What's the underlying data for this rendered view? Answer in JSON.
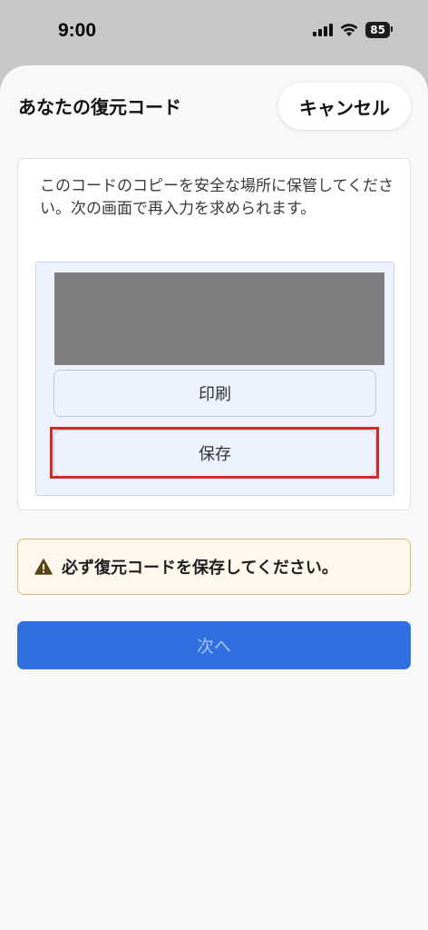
{
  "status_bar": {
    "time": "9:00",
    "battery": "85"
  },
  "sheet": {
    "title": "あなたの復元コード",
    "cancel_label": "キャンセル"
  },
  "card": {
    "description": "このコードのコピーを安全な場所に保管してください。次の画面で再入力を求められます。",
    "print_label": "印刷",
    "save_label": "保存"
  },
  "warning": {
    "text": "必ず復元コードを保存してください。",
    "icon": "warning-triangle-icon"
  },
  "footer": {
    "next_label": "次へ"
  },
  "colors": {
    "accent": "#2f6fe0",
    "highlight": "#d22a2a",
    "warning_border": "#e3b873"
  }
}
